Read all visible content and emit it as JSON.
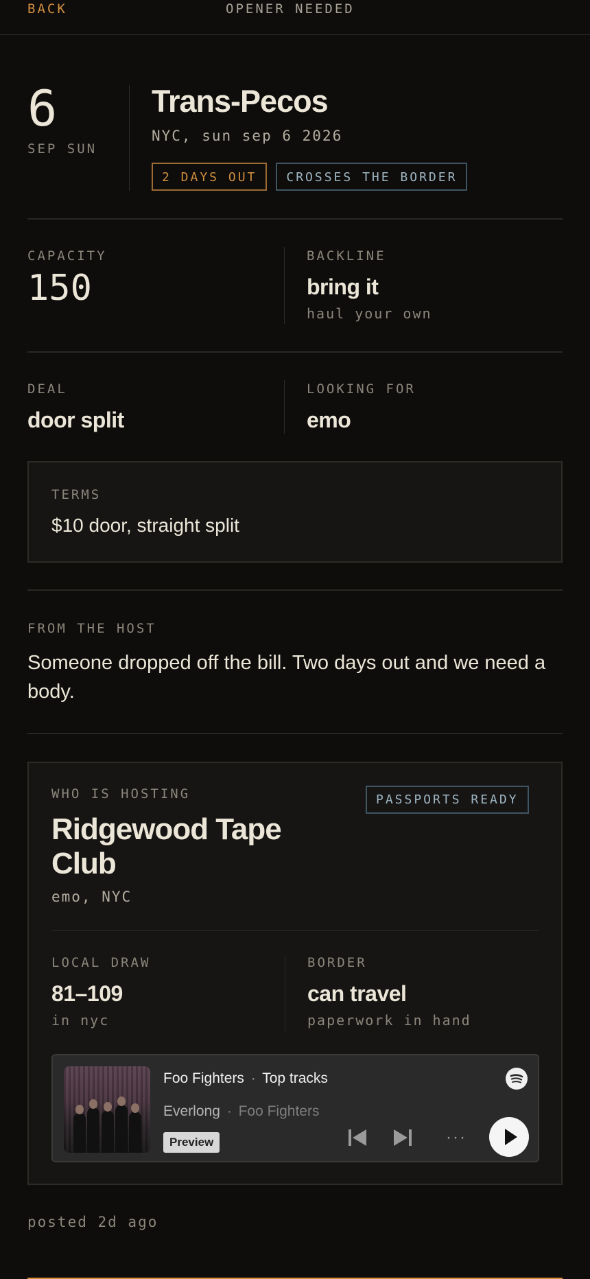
{
  "topbar": {
    "back_label": "BACK",
    "title": "OPENER NEEDED"
  },
  "event": {
    "day": "6",
    "month_weekday": "SEP SUN",
    "venue": "Trans-Pecos",
    "location_date": "NYC, sun sep 6 2026",
    "tags": [
      "2 DAYS OUT",
      "CROSSES THE BORDER"
    ]
  },
  "details": {
    "capacity_label": "CAPACITY",
    "capacity_value": "150",
    "backline_label": "BACKLINE",
    "backline_value": "bring it",
    "backline_note": "haul your own",
    "deal_label": "DEAL",
    "deal_value": "door split",
    "looking_label": "LOOKING FOR",
    "looking_value": "emo"
  },
  "terms": {
    "label": "TERMS",
    "value": "$10 door, straight split"
  },
  "host_note": {
    "label": "FROM THE HOST",
    "text": "Someone dropped off the bill. Two days out and we need a body."
  },
  "hosting": {
    "label": "WHO IS HOSTING",
    "badge": "PASSPORTS READY",
    "name": "Ridgewood Tape Club",
    "sub": "emo, NYC",
    "draw_label": "LOCAL DRAW",
    "draw_value": "81–109",
    "draw_note": "in nyc",
    "border_label": "BORDER",
    "border_value": "can travel",
    "border_note": "paperwork in hand"
  },
  "player": {
    "title": "Foo Fighters",
    "title_sep": "·",
    "title_suffix": "Top tracks",
    "track": "Everlong",
    "track_sep": "·",
    "artist": "Foo Fighters",
    "preview_label": "Preview",
    "more_label": "···"
  },
  "footer": {
    "posted": "posted 2d ago"
  },
  "colors": {
    "accent": "#d28e3f",
    "tag_blue": "#9fb6c4",
    "background": "#0e0d0b"
  }
}
